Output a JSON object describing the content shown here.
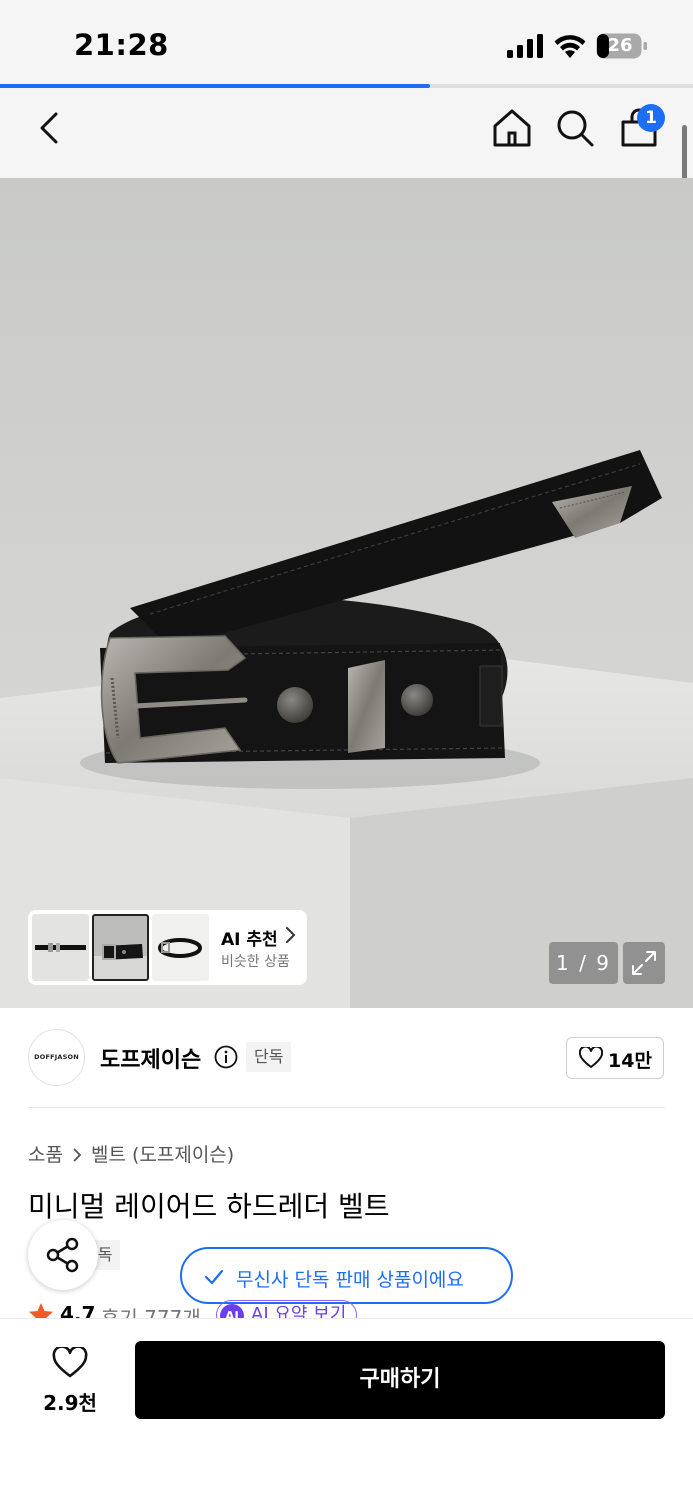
{
  "status": {
    "time": "21:28",
    "battery": "26"
  },
  "page_progress": 0.62,
  "nav": {
    "cart_count": "1"
  },
  "gallery": {
    "ai_title": "AI 추천",
    "ai_subtitle": "비슷한 상품",
    "counter": "1 / 9"
  },
  "brand": {
    "logo_text": "DOFFJASON",
    "name": "도프제이슨",
    "exclusive_label": "단독",
    "likes": "14만"
  },
  "breadcrumb": {
    "category": "소품",
    "subcategory": "벨트 (도프제이슨)"
  },
  "product": {
    "title": "미니멀 레이어드 하드레더 벨트",
    "badge": "단독"
  },
  "toast": {
    "message": "무신사 단독 판매 상품이에요"
  },
  "rating": {
    "score": "4.7",
    "reviews": "후기 777개",
    "ai_summary": "AI 요약 보기",
    "ai_badge": "AI"
  },
  "bottom": {
    "wish_count": "2.9천",
    "buy_label": "구매하기"
  },
  "colors": {
    "accent": "#1e6ef5",
    "ai_purple": "#6b3ff0",
    "star": "#f15a24"
  }
}
